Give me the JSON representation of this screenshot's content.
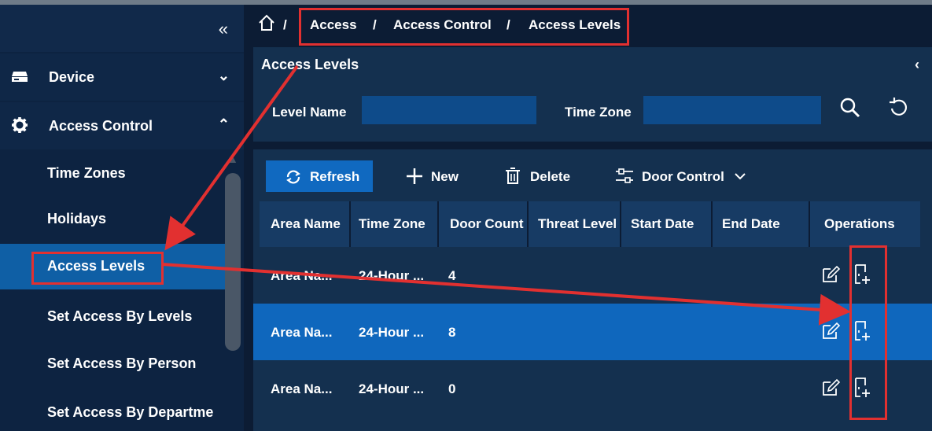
{
  "sidebar": {
    "collapse_glyph": "«",
    "groups": [
      {
        "label": "Device",
        "icon": "device-icon",
        "arrow": "⌄"
      },
      {
        "label": "Access Control",
        "icon": "gear-icon",
        "arrow": "⌃"
      }
    ],
    "items": [
      {
        "label": "Time Zones"
      },
      {
        "label": "Holidays"
      },
      {
        "label": "Access Levels"
      },
      {
        "label": "Set Access By Levels"
      },
      {
        "label": "Set Access By Person"
      },
      {
        "label": "Set Access By Departme"
      }
    ]
  },
  "breadcrumb": {
    "separator": "/",
    "items": [
      "Access",
      "Access Control",
      "Access Levels"
    ]
  },
  "panel": {
    "title": "Access Levels",
    "collapse_glyph": "‹",
    "filters": {
      "level_name_label": "Level Name",
      "level_name_value": "",
      "time_zone_label": "Time Zone",
      "time_zone_value": ""
    }
  },
  "toolbar": {
    "refresh": "Refresh",
    "new": "New",
    "delete": "Delete",
    "door_control": "Door Control"
  },
  "table": {
    "columns": [
      "Area Name",
      "Time Zone",
      "Door Count",
      "Threat Level",
      "Start Date",
      "End Date",
      "Operations"
    ],
    "rows": [
      {
        "area_name": "Area Na...",
        "time_zone": "24-Hour ...",
        "door_count": "4",
        "threat_level": "",
        "start_date": "",
        "end_date": ""
      },
      {
        "area_name": "Area Na...",
        "time_zone": "24-Hour ...",
        "door_count": "8",
        "threat_level": "",
        "start_date": "",
        "end_date": ""
      },
      {
        "area_name": "Area Na...",
        "time_zone": "24-Hour ...",
        "door_count": "0",
        "threat_level": "",
        "start_date": "",
        "end_date": ""
      }
    ]
  },
  "colors": {
    "accent": "#1069c0",
    "selected_row": "#0f67bd",
    "annotation": "#e23030",
    "sidebar_active": "#0f5fa5"
  }
}
